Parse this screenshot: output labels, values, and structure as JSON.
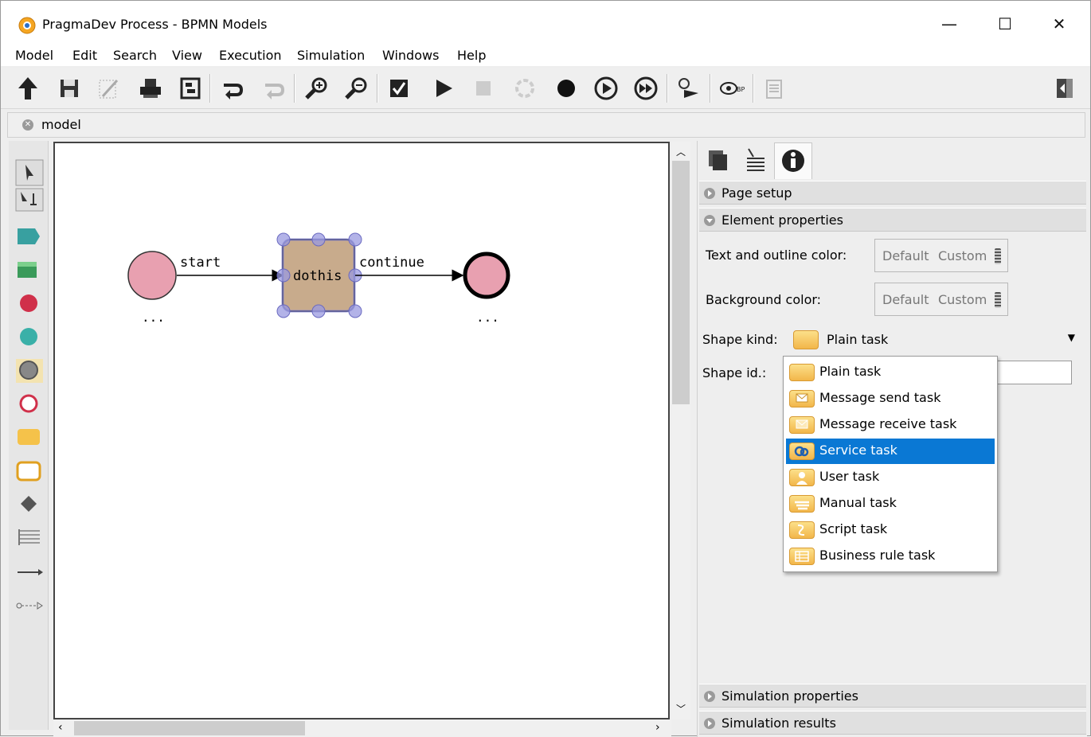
{
  "window": {
    "title": "PragmaDev Process - BPMN Models",
    "controls": {
      "minimize": "—",
      "maximize": "☐",
      "close": "✕"
    }
  },
  "menu": [
    "Model",
    "Edit",
    "Search",
    "View",
    "Execution",
    "Simulation",
    "Windows",
    "Help"
  ],
  "toolbar": {
    "icons": [
      "up-arrow-icon",
      "save-icon",
      "design-icon",
      "print-icon",
      "export-icon",
      "undo-icon",
      "redo-icon",
      "zoom-in-icon",
      "zoom-out-icon",
      "check-icon",
      "play-icon",
      "stop-icon",
      "restart-icon",
      "breakpoint-icon",
      "step-icon",
      "step-over-icon",
      "trace-icon",
      "observer-icon",
      "report-icon",
      "panel-toggle-icon"
    ]
  },
  "tab": {
    "label": "model"
  },
  "palette": {
    "icons": [
      "select-tool-icon",
      "multi-select-tool-icon",
      "pool-icon",
      "lane-icon",
      "start-event-icon",
      "intermediate-event-icon",
      "gray-event-icon",
      "end-event-icon",
      "task-icon",
      "subprocess-icon",
      "gateway-icon",
      "annotation-icon",
      "sequence-flow-icon",
      "message-flow-icon"
    ]
  },
  "diagram": {
    "start_label": "start",
    "start_dots": "...",
    "task_label": "dothis",
    "continue_label": "continue",
    "end_dots": "...",
    "colors": {
      "event_fill": "#e8a0b0",
      "task_fill": "#c8ab8c",
      "selection": "#8080d0"
    }
  },
  "right_panel": {
    "tabs": [
      "pages-icon",
      "properties-list-icon",
      "info-icon"
    ],
    "sections": {
      "page_setup": "Page setup",
      "element_properties": "Element properties",
      "simulation_properties": "Simulation properties",
      "simulation_results": "Simulation results"
    },
    "text_color_label": "Text and outline color:",
    "bg_color_label": "Background color:",
    "color_default": "Default",
    "color_custom": "Custom",
    "shape_kind_label": "Shape kind:",
    "shape_kind_value": "Plain task",
    "shape_id_label": "Shape id.:"
  },
  "shape_kind_options": [
    {
      "label": "Plain task",
      "icon": "plain-task-icon",
      "selected": false
    },
    {
      "label": "Message send task",
      "icon": "message-send-icon",
      "selected": false
    },
    {
      "label": "Message receive task",
      "icon": "message-receive-icon",
      "selected": false
    },
    {
      "label": "Service task",
      "icon": "service-task-icon",
      "selected": true
    },
    {
      "label": "User task",
      "icon": "user-task-icon",
      "selected": false
    },
    {
      "label": "Manual task",
      "icon": "manual-task-icon",
      "selected": false
    },
    {
      "label": "Script task",
      "icon": "script-task-icon",
      "selected": false
    },
    {
      "label": "Business rule task",
      "icon": "business-rule-icon",
      "selected": false
    }
  ],
  "accent": "#0a78d4"
}
